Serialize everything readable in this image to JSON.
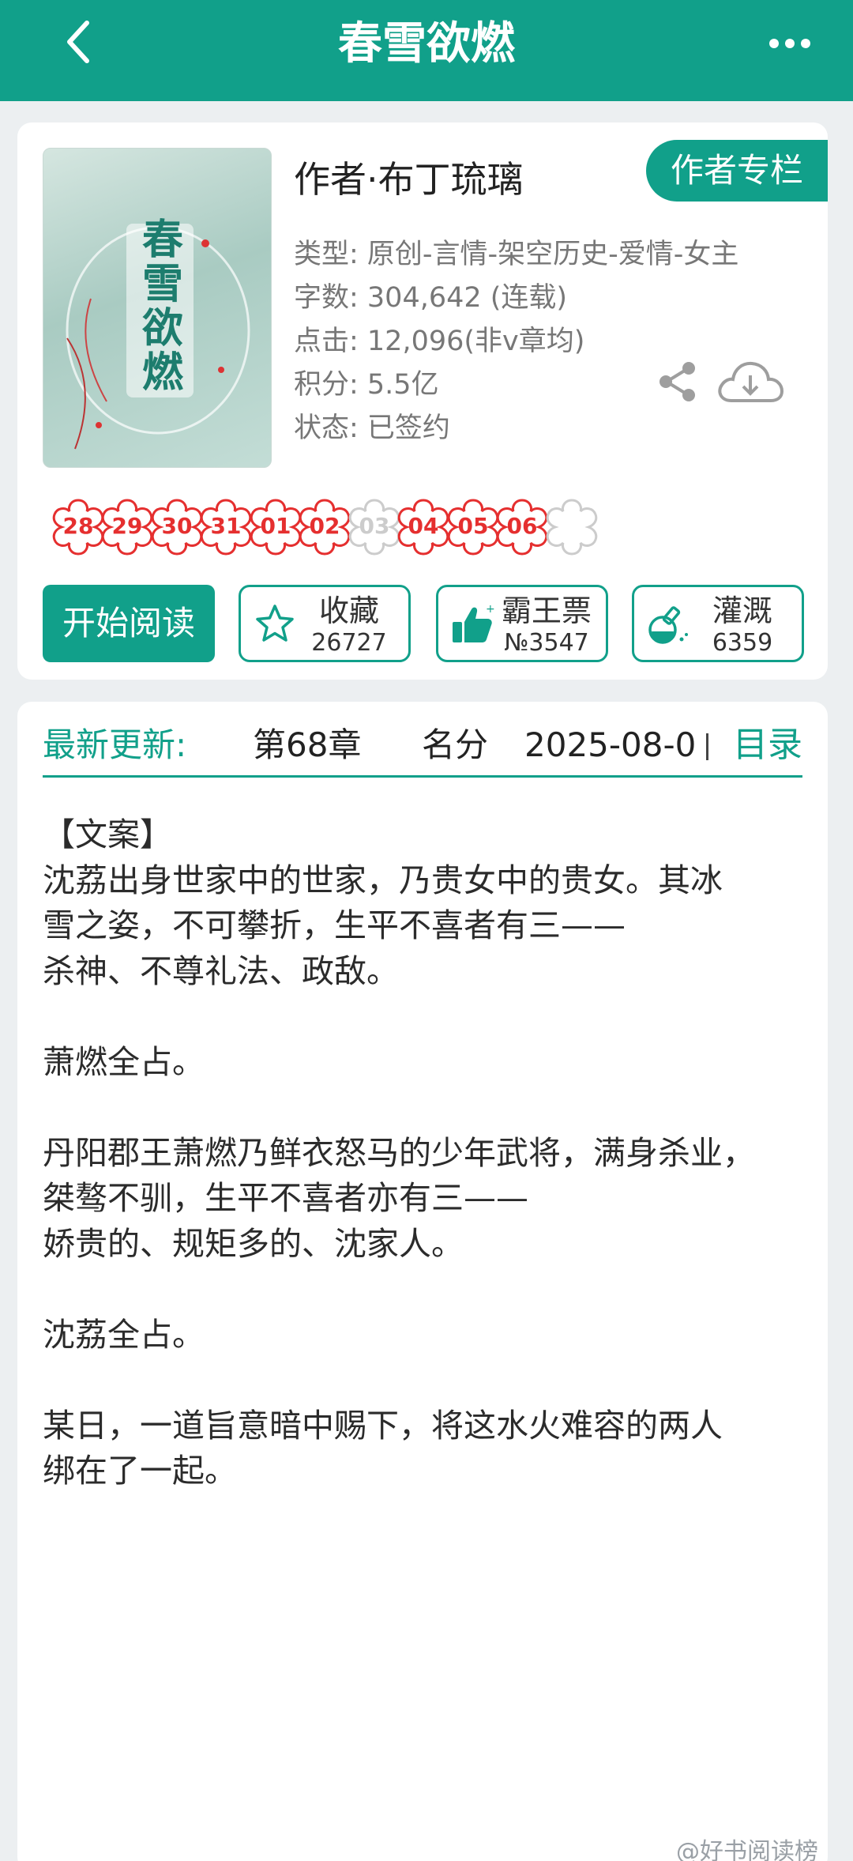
{
  "header": {
    "title": "春雪欲燃",
    "back_icon": "chevron-left-icon",
    "more_icon": "more-dots-icon",
    "background": "#11a08a"
  },
  "book": {
    "cover_title_chars": [
      "春",
      "雪",
      "欲",
      "燃"
    ],
    "author": "作者·布丁琉璃",
    "author_column_label": "作者专栏",
    "meta": {
      "genre": "类型: 原创-言情-架空历史-爱情-女主",
      "word_count": "字数: 304,642 (连载)",
      "clicks": "点击: 12,096(非v章均)",
      "score": "积分: 5.5亿",
      "status": "状态: 已签约"
    },
    "share_icon": "share-icon",
    "download_icon": "cloud-download-icon"
  },
  "update_dates": [
    {
      "day": "28",
      "updated": true
    },
    {
      "day": "29",
      "updated": true
    },
    {
      "day": "30",
      "updated": true
    },
    {
      "day": "31",
      "updated": true
    },
    {
      "day": "01",
      "updated": true
    },
    {
      "day": "02",
      "updated": true
    },
    {
      "day": "03",
      "updated": false
    },
    {
      "day": "04",
      "updated": true
    },
    {
      "day": "05",
      "updated": true
    },
    {
      "day": "06",
      "updated": true
    }
  ],
  "actions": {
    "start_reading": "开始阅读",
    "favorite": {
      "label": "收藏",
      "count": "26727",
      "icon": "star-icon"
    },
    "vote": {
      "label": "霸王票",
      "count": "№3547",
      "icon": "thumbs-up-icon"
    },
    "water": {
      "label": "灌溉",
      "count": "6359",
      "icon": "bottle-icon"
    }
  },
  "latest": {
    "label": "最新更新:",
    "chapter": "第68章",
    "name": "名分",
    "date": "2025-08-0",
    "toc": "目录"
  },
  "description": [
    "【文案】",
    "沈荔出身世家中的世家，乃贵女中的贵女。其冰",
    "雪之姿，不可攀折，生平不喜者有三——",
    "杀神、不尊礼法、政敌。",
    "",
    "萧燃全占。",
    "",
    "丹阳郡王萧燃乃鲜衣怒马的少年武将，满身杀业，",
    "桀骜不驯，生平不喜者亦有三——",
    "娇贵的、规矩多的、沈家人。",
    "",
    "沈荔全占。",
    "",
    "某日，一道旨意暗中赐下，将这水火难容的两人",
    "绑在了一起。"
  ],
  "watermark": "@好书阅读榜",
  "colors": {
    "accent": "#11a08a",
    "date_updated": "#e52f2f",
    "date_missed": "#cccccc"
  }
}
